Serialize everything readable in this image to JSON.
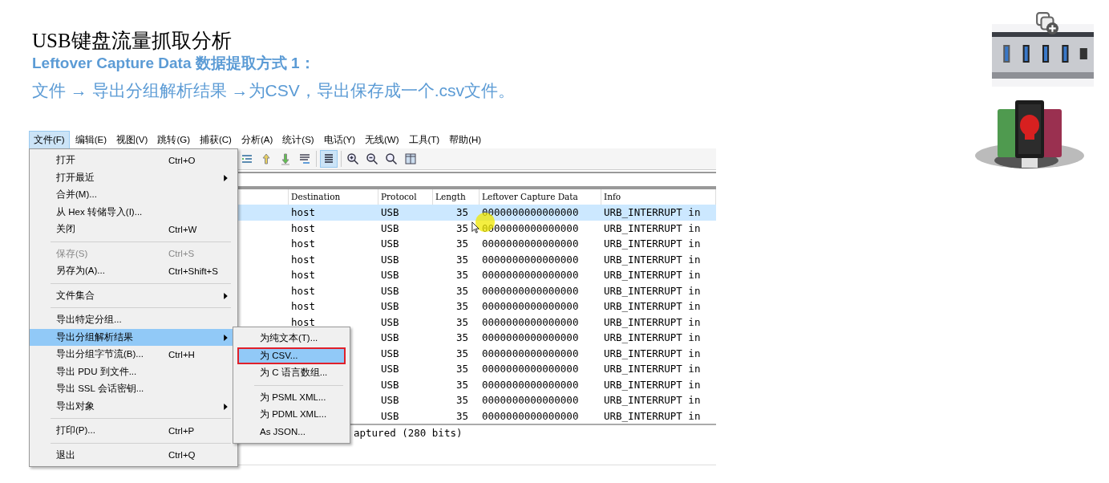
{
  "slide": {
    "title": "USB键盘流量抓取分析",
    "subtitle": "Leftover Capture Data 数据提取方式 1：",
    "instruction": "文件 → 导出分组解析结果 →为CSV，导出保存成一个.csv文件。"
  },
  "menu_bar": [
    {
      "label": "文件(F)",
      "selected": true
    },
    {
      "label": "编辑(E)",
      "selected": false
    },
    {
      "label": "视图(V)",
      "selected": false
    },
    {
      "label": "跳转(G)",
      "selected": false
    },
    {
      "label": "捕获(C)",
      "selected": false
    },
    {
      "label": "分析(A)",
      "selected": false
    },
    {
      "label": "统计(S)",
      "selected": false
    },
    {
      "label": "电话(Y)",
      "selected": false
    },
    {
      "label": "无线(W)",
      "selected": false
    },
    {
      "label": "工具(T)",
      "selected": false
    },
    {
      "label": "帮助(H)",
      "selected": false
    }
  ],
  "file_menu": [
    [
      {
        "label": "打开",
        "shortcut": "Ctrl+O",
        "submenu": false,
        "disabled": false,
        "selected": false
      },
      {
        "label": "打开最近",
        "submenu": true,
        "disabled": false,
        "selected": false
      },
      {
        "label": "合并(M)...",
        "submenu": false,
        "disabled": false,
        "selected": false
      },
      {
        "label": "从 Hex 转储导入(I)...",
        "submenu": false,
        "disabled": false,
        "selected": false
      },
      {
        "label": "关闭",
        "shortcut": "Ctrl+W",
        "submenu": false,
        "disabled": false,
        "selected": false
      }
    ],
    [
      {
        "label": "保存(S)",
        "shortcut": "Ctrl+S",
        "submenu": false,
        "disabled": true,
        "selected": false
      },
      {
        "label": "另存为(A)...",
        "shortcut": "Ctrl+Shift+S",
        "submenu": false,
        "disabled": false,
        "selected": false
      }
    ],
    [
      {
        "label": "文件集合",
        "submenu": true,
        "disabled": false,
        "selected": false
      }
    ],
    [
      {
        "label": "导出特定分组...",
        "submenu": false,
        "disabled": false,
        "selected": false
      },
      {
        "label": "导出分组解析结果",
        "submenu": true,
        "disabled": false,
        "selected": true
      },
      {
        "label": "导出分组字节流(B)...",
        "shortcut": "Ctrl+H",
        "submenu": false,
        "disabled": false,
        "selected": false
      },
      {
        "label": "导出 PDU 到文件...",
        "submenu": false,
        "disabled": false,
        "selected": false
      },
      {
        "label": "导出 SSL 会话密钥...",
        "submenu": false,
        "disabled": false,
        "selected": false
      },
      {
        "label": "导出对象",
        "submenu": true,
        "disabled": false,
        "selected": false
      }
    ],
    [
      {
        "label": "打印(P)...",
        "shortcut": "Ctrl+P",
        "submenu": false,
        "disabled": false,
        "selected": false
      }
    ],
    [
      {
        "label": "退出",
        "shortcut": "Ctrl+Q",
        "submenu": false,
        "disabled": false,
        "selected": false
      }
    ]
  ],
  "export_submenu": [
    [
      {
        "label": "为纯文本(T)...",
        "selected": false
      },
      {
        "label": "为 CSV...",
        "selected": true
      },
      {
        "label": "为 C 语言数组...",
        "selected": false
      }
    ],
    [
      {
        "label": "为 PSML XML...",
        "selected": false
      },
      {
        "label": "为 PDML XML...",
        "selected": false
      },
      {
        "label": "As JSON...",
        "selected": false
      }
    ]
  ],
  "packet_list": {
    "columns": [
      "Destination",
      "Protocol",
      "Length",
      "Leftover Capture Data",
      "Info"
    ],
    "rows": [
      {
        "destination": "host",
        "protocol": "USB",
        "length": "35",
        "data": "0000000000000000",
        "info": "URB_INTERRUPT in",
        "selected": true
      },
      {
        "destination": "host",
        "protocol": "USB",
        "length": "35",
        "data": "0000000000000000",
        "info": "URB_INTERRUPT in",
        "selected": false
      },
      {
        "destination": "host",
        "protocol": "USB",
        "length": "35",
        "data": "0000000000000000",
        "info": "URB_INTERRUPT in",
        "selected": false
      },
      {
        "destination": "host",
        "protocol": "USB",
        "length": "35",
        "data": "0000000000000000",
        "info": "URB_INTERRUPT in",
        "selected": false
      },
      {
        "destination": "host",
        "protocol": "USB",
        "length": "35",
        "data": "0000000000000000",
        "info": "URB_INTERRUPT in",
        "selected": false
      },
      {
        "destination": "host",
        "protocol": "USB",
        "length": "35",
        "data": "0000000000000000",
        "info": "URB_INTERRUPT in",
        "selected": false
      },
      {
        "destination": "host",
        "protocol": "USB",
        "length": "35",
        "data": "0000000000000000",
        "info": "URB_INTERRUPT in",
        "selected": false
      },
      {
        "destination": "host",
        "protocol": "USB",
        "length": "35",
        "data": "0000000000000000",
        "info": "URB_INTERRUPT in",
        "selected": false
      },
      {
        "protocol": "USB",
        "length": "35",
        "data": "0000000000000000",
        "info": "URB_INTERRUPT in",
        "selected": false
      },
      {
        "protocol": "USB",
        "length": "35",
        "data": "0000000000000000",
        "info": "URB_INTERRUPT in",
        "selected": false
      },
      {
        "protocol": "USB",
        "length": "35",
        "data": "0000000000000000",
        "info": "URB_INTERRUPT in",
        "selected": false
      },
      {
        "protocol": "USB",
        "length": "35",
        "data": "0000000000000000",
        "info": "URB_INTERRUPT in",
        "selected": false
      },
      {
        "protocol": "USB",
        "length": "35",
        "data": "0000000000000000",
        "info": "URB_INTERRUPT in",
        "selected": false
      },
      {
        "protocol": "USB",
        "length": "35",
        "data": "0000000000000000",
        "info": "URB_INTERRUPT in",
        "selected": false
      }
    ]
  },
  "status_bar": "aptured (280 bits)"
}
